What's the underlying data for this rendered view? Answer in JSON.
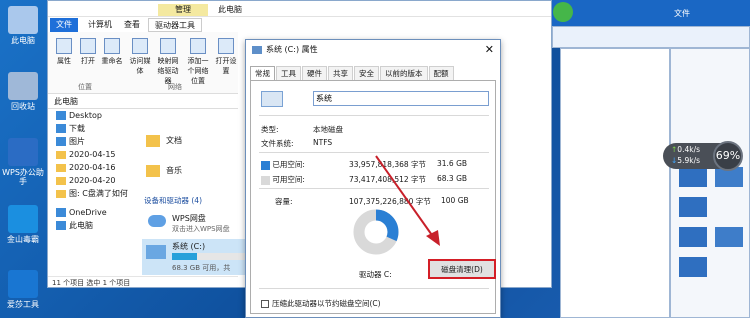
{
  "desktop": {
    "icons": [
      {
        "label": "此电脑"
      },
      {
        "label": "回收站"
      },
      {
        "label": "WPS办公助手"
      },
      {
        "label": "金山毒霸"
      },
      {
        "label": "爱莎工具"
      }
    ]
  },
  "explorer": {
    "title": "此电脑",
    "context_tab": "管理",
    "ribbon_tabs": [
      "文件",
      "计算机",
      "查看",
      "驱动器工具"
    ],
    "ribbon_buttons": [
      "属性",
      "打开",
      "重命名",
      "访问媒体",
      "映射网络驱动器",
      "添加一个网络位置",
      "打开设置"
    ],
    "groups": [
      "位置",
      "网络"
    ],
    "address": "此电脑",
    "nav": [
      "Desktop",
      "下载",
      "图片",
      "2020-04-15",
      "2020-04-16",
      "2020-04-20",
      "图: C盘满了如何",
      "OneDrive",
      "此电脑"
    ],
    "content": {
      "folders": [
        "文档",
        "音乐"
      ],
      "section": "设备和驱动器 (4)",
      "wps": {
        "name": "WPS网盘",
        "desc": "双击进入WPS网盘"
      },
      "drive": {
        "name": "系统 (C:)",
        "free": "68.3 GB 可用，共"
      }
    },
    "status": "11 个项目    选中 1 个项目"
  },
  "right_window": {
    "title": "文件"
  },
  "dialog": {
    "title": "系统 (C:) 属性",
    "tabs": [
      "常规",
      "工具",
      "硬件",
      "共享",
      "安全",
      "以前的版本",
      "配额"
    ],
    "volume_name": "系统",
    "type_label": "类型:",
    "type_value": "本地磁盘",
    "fs_label": "文件系统:",
    "fs_value": "NTFS",
    "used_label": "已用空间:",
    "used_bytes": "33,957,818,368 字节",
    "used_gb": "31.6 GB",
    "free_label": "可用空间:",
    "free_bytes": "73,417,408,512 字节",
    "free_gb": "68.3 GB",
    "cap_label": "容量:",
    "cap_bytes": "107,375,226,880 字节",
    "cap_gb": "100 GB",
    "drive_label": "驱动器 C:",
    "cleanup_button": "磁盘清理(D)",
    "compress_checkbox": "压缩此驱动器以节约磁盘空间(C)",
    "used_fraction": 0.316
  },
  "widget": {
    "up": "0.4k/s",
    "down": "5.9k/s",
    "percent": "69%"
  },
  "colors": {
    "used": "#2a7fd4",
    "free": "#d9d9d9",
    "accent": "#1e6fd9",
    "arrow": "#c8202a"
  }
}
